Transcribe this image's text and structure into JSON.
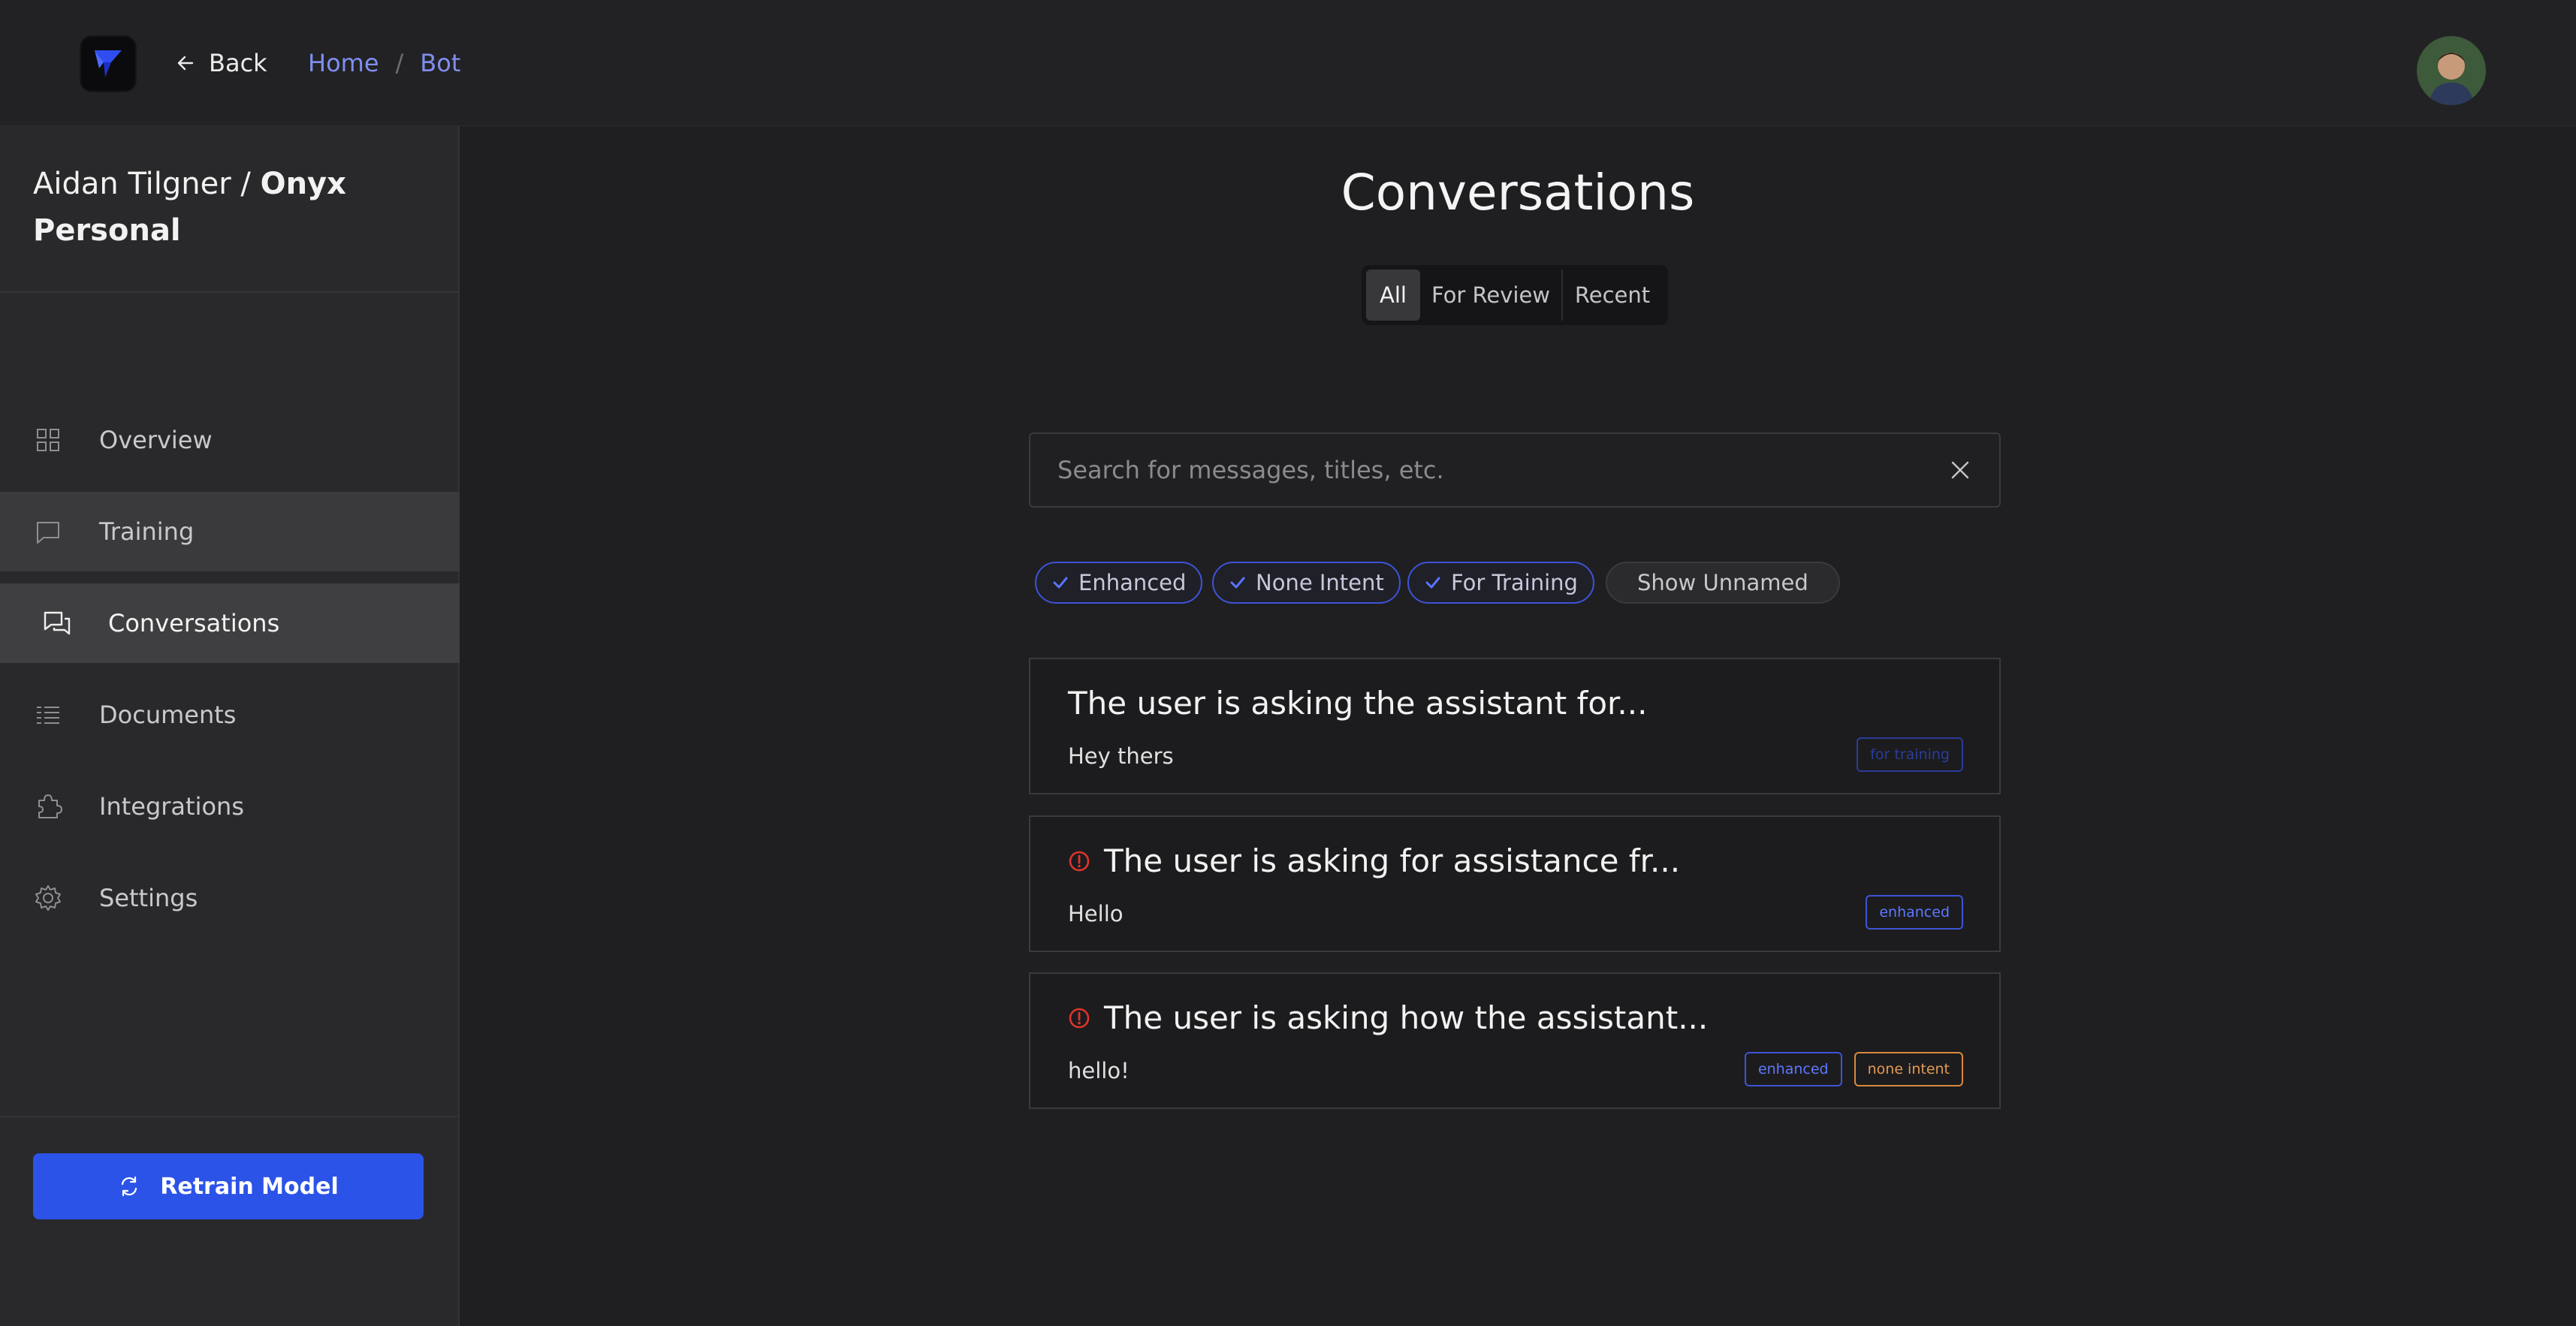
{
  "header": {
    "back_label": "Back",
    "breadcrumb": [
      "Home",
      "Bot"
    ]
  },
  "sidebar": {
    "workspace_owner": "Aidan Tilgner / ",
    "workspace_name": "Onyx Personal",
    "items": [
      {
        "label": "Overview",
        "icon": "grid-icon"
      },
      {
        "label": "Training",
        "icon": "chat-bubble-icon"
      },
      {
        "label": "Conversations",
        "icon": "chat-bubbles-icon"
      },
      {
        "label": "Documents",
        "icon": "list-icon"
      },
      {
        "label": "Integrations",
        "icon": "puzzle-icon"
      },
      {
        "label": "Settings",
        "icon": "gear-icon"
      }
    ],
    "retrain_label": "Retrain Model"
  },
  "main": {
    "title": "Conversations",
    "tabs": [
      "All",
      "For Review",
      "Recent"
    ],
    "selected_tab": "All",
    "search": {
      "placeholder": "Search for messages, titles, etc.",
      "value": ""
    },
    "filters": [
      {
        "label": "Enhanced",
        "checked": true
      },
      {
        "label": "None Intent",
        "checked": true
      },
      {
        "label": "For Training",
        "checked": true
      },
      {
        "label": "Show Unnamed",
        "checked": false
      }
    ],
    "conversations": [
      {
        "title": "The user is asking the assistant for...",
        "snippet": "Hey thers",
        "warning": false,
        "tags": [
          "for training"
        ]
      },
      {
        "title": "The user is asking for assistance fr...",
        "snippet": "Hello",
        "warning": true,
        "tags": [
          "enhanced"
        ]
      },
      {
        "title": "The user is asking how the assistant...",
        "snippet": "hello!",
        "warning": true,
        "tags": [
          "enhanced",
          "none intent"
        ]
      }
    ]
  },
  "colors": {
    "accent": "#2c53e8",
    "chip_border": "#3d54d6",
    "warning": "#e0342c",
    "tag_orange": "#e39a52",
    "link": "#7f8ef0"
  }
}
